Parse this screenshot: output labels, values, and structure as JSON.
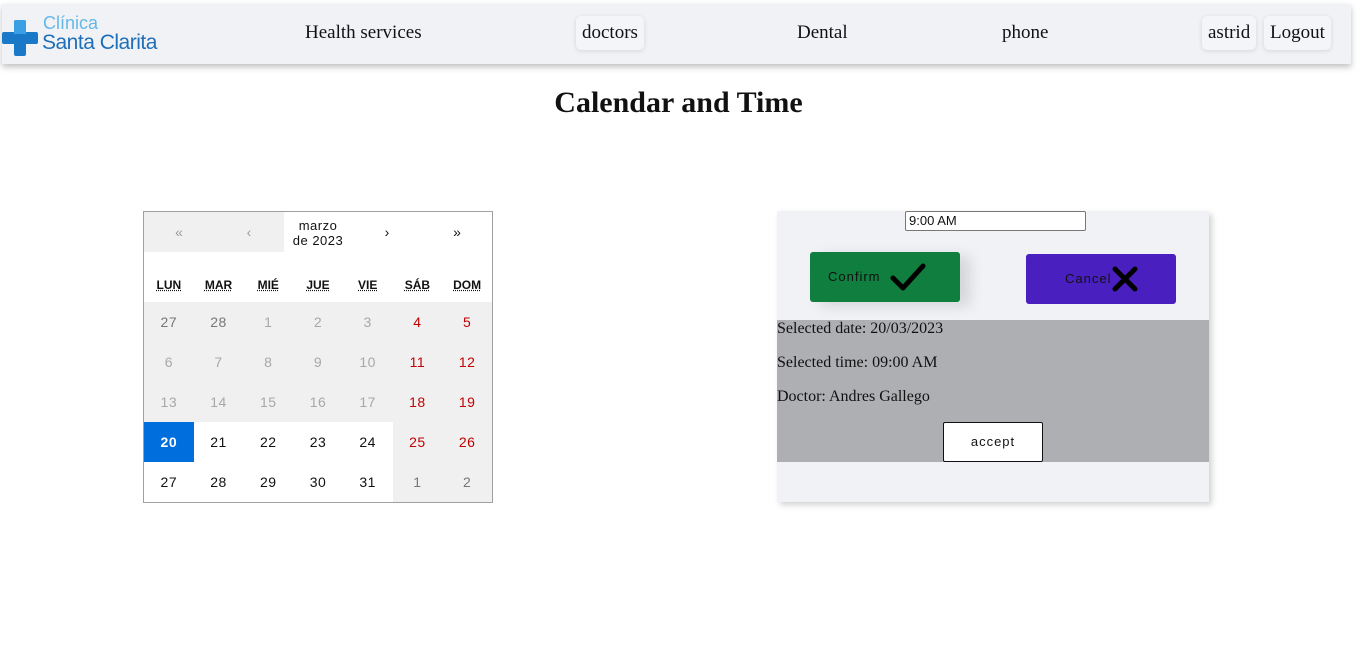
{
  "logo": {
    "top": "Clínica",
    "bottom": "Santa Clarita"
  },
  "nav": {
    "health_services": "Health services",
    "doctors": "doctors",
    "dental": "Dental",
    "phone": "phone",
    "user": "astrid",
    "logout": "Logout"
  },
  "page": {
    "title": "Calendar and Time"
  },
  "calendar": {
    "nav": {
      "prev2": "«",
      "prev": "‹",
      "next": "›",
      "next2": "»"
    },
    "month_line1": "marzo",
    "month_line2": "de 2023",
    "weekdays": [
      "LUN",
      "MAR",
      "MIÉ",
      "JUE",
      "VIE",
      "SÁB",
      "DOM"
    ],
    "weeks": [
      [
        "27",
        "28",
        "1",
        "2",
        "3",
        "4",
        "5"
      ],
      [
        "6",
        "7",
        "8",
        "9",
        "10",
        "11",
        "12"
      ],
      [
        "13",
        "14",
        "15",
        "16",
        "17",
        "18",
        "19"
      ],
      [
        "20",
        "21",
        "22",
        "23",
        "24",
        "25",
        "26"
      ],
      [
        "27",
        "28",
        "29",
        "30",
        "31",
        "1",
        "2"
      ]
    ],
    "selected_day": "20",
    "selected_color": "#006edc",
    "weekend_color": "#c00000"
  },
  "booking": {
    "time_value": "9:00 AM",
    "confirm_label": "Confirm",
    "cancel_label": "Cancel",
    "confirm_color": "#0f7e3e",
    "cancel_color": "#4a1fc0",
    "selected_date": "Selected date: 20/03/2023",
    "selected_time": "Selected time: 09:00 AM",
    "doctor": "Doctor: Andres Gallego",
    "accept_label": "accept"
  }
}
